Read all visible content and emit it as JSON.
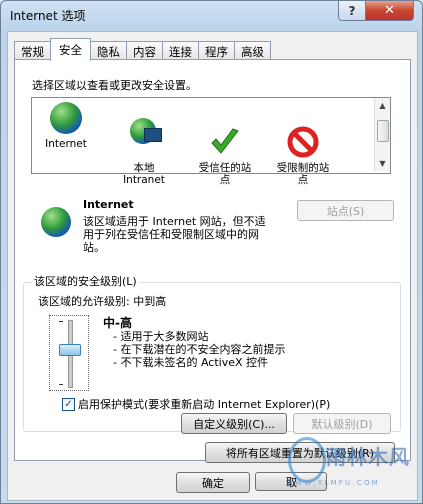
{
  "window": {
    "title": "Internet 选项",
    "help_glyph": "?",
    "close_glyph": "✕"
  },
  "tabs": [
    "常规",
    "安全",
    "隐私",
    "内容",
    "连接",
    "程序",
    "高级"
  ],
  "active_tab": "安全",
  "zones": {
    "prompt": "选择区域以查看或更改安全设置。",
    "items": [
      {
        "label": "Internet",
        "icon": "globe-icon"
      },
      {
        "label": "本地\nIntranet",
        "icon": "intranet-icon"
      },
      {
        "label": "受信任的站\n点",
        "icon": "checkmark-icon"
      },
      {
        "label": "受限制的站\n点",
        "icon": "restricted-icon"
      }
    ]
  },
  "zone_detail": {
    "name": "Internet",
    "description": "该区域适用于 Internet 网站，但不适用于列在受信任和受限制区域中的网站。",
    "sites_button": "站点(S)"
  },
  "security_level": {
    "group_label": "该区域的安全级别(L)",
    "allowed_label": "该区域的允许级别: 中到高",
    "level_name": "中-高",
    "bullets": [
      "- 适用于大多数网站",
      "- 在下载潜在的不安全内容之前提示",
      "- 不下载未签名的 ActiveX 控件"
    ],
    "protected_mode": "启用保护模式(要求重新启动 Internet Explorer)(P)",
    "protected_mode_checked": true,
    "custom_button": "自定义级别(C)...",
    "default_button": "默认级别(D)"
  },
  "reset_all_button": "将所有区域重置为默认级别(R)",
  "footer": {
    "ok": "确定",
    "cancel": "取"
  },
  "watermark": {
    "brand": "雨林木风",
    "url": "W W W . Y L M F U . C O M"
  }
}
